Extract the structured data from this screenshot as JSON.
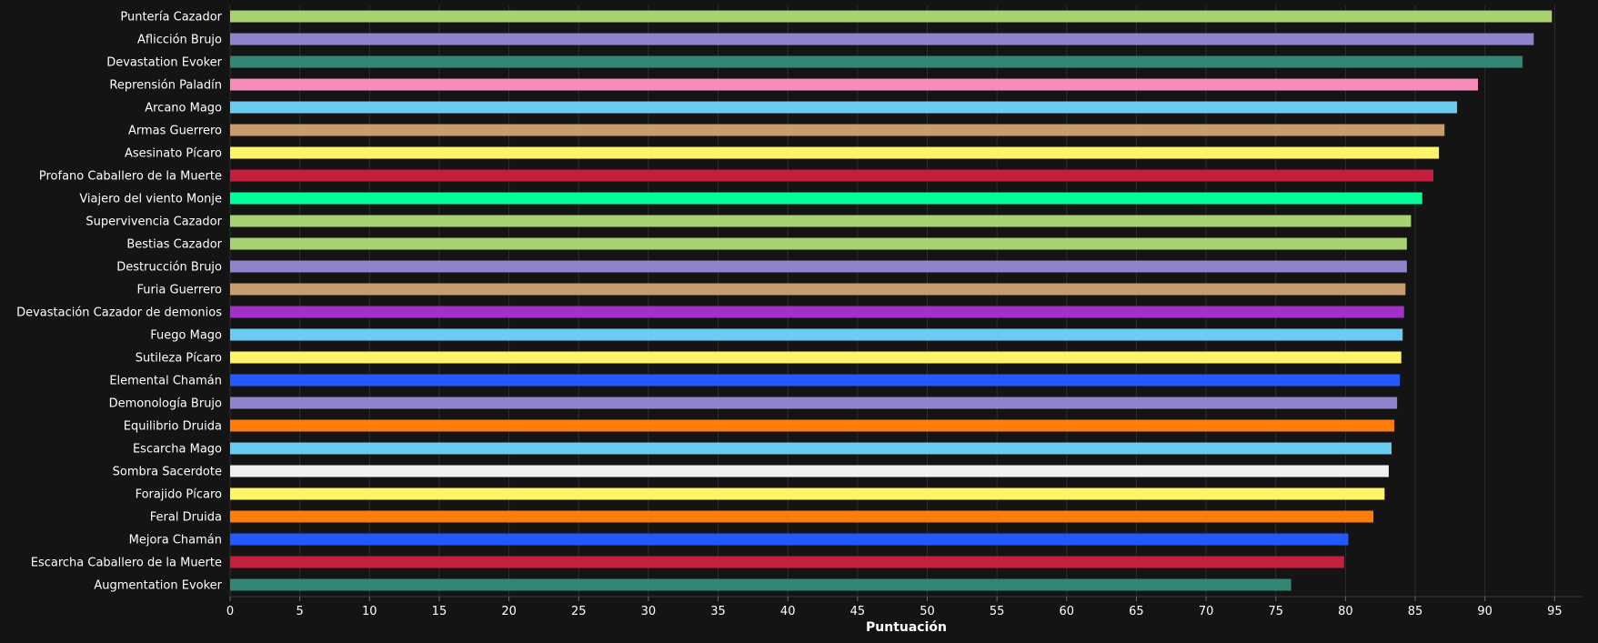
{
  "chart_data": {
    "type": "bar",
    "orientation": "horizontal",
    "title": "",
    "xlabel": "Puntuación",
    "ylabel": "",
    "xlim": [
      0,
      97
    ],
    "xticks": [
      0,
      5,
      10,
      15,
      20,
      25,
      30,
      35,
      40,
      45,
      50,
      55,
      60,
      65,
      70,
      75,
      80,
      85,
      90,
      95
    ],
    "grid": true,
    "legend": "none",
    "background_color": "#141414",
    "bars": [
      {
        "label": "Puntería Cazador",
        "value": 94.8,
        "color": "#a9d271"
      },
      {
        "label": "Aflicción Brujo",
        "value": 93.5,
        "color": "#8f84cb"
      },
      {
        "label": "Devastation Evoker",
        "value": 92.7,
        "color": "#338673"
      },
      {
        "label": "Reprensión Paladín",
        "value": 89.5,
        "color": "#f58cba"
      },
      {
        "label": "Arcano Mago",
        "value": 88.0,
        "color": "#69ccf0"
      },
      {
        "label": "Armas Guerrero",
        "value": 87.1,
        "color": "#c79c6e"
      },
      {
        "label": "Asesinato Pícaro",
        "value": 86.7,
        "color": "#fff468"
      },
      {
        "label": "Profano Caballero de la Muerte",
        "value": 86.3,
        "color": "#c41f3b"
      },
      {
        "label": "Viajero del viento Monje",
        "value": 85.5,
        "color": "#00ff96"
      },
      {
        "label": "Supervivencia Cazador",
        "value": 84.7,
        "color": "#a9d271"
      },
      {
        "label": "Bestias Cazador",
        "value": 84.4,
        "color": "#a9d271"
      },
      {
        "label": "Destrucción Brujo",
        "value": 84.4,
        "color": "#8f84cb"
      },
      {
        "label": "Furia Guerrero",
        "value": 84.3,
        "color": "#c79c6e"
      },
      {
        "label": "Devastación Cazador de demonios",
        "value": 84.2,
        "color": "#a330c9"
      },
      {
        "label": "Fuego Mago",
        "value": 84.1,
        "color": "#69ccf0"
      },
      {
        "label": "Sutileza Pícaro",
        "value": 84.0,
        "color": "#fff468"
      },
      {
        "label": "Elemental Chamán",
        "value": 83.9,
        "color": "#2459ff"
      },
      {
        "label": "Demonología Brujo",
        "value": 83.7,
        "color": "#8f84cb"
      },
      {
        "label": "Equilibrio Druida",
        "value": 83.5,
        "color": "#ff7d0a"
      },
      {
        "label": "Escarcha Mago",
        "value": 83.3,
        "color": "#69ccf0"
      },
      {
        "label": "Sombra Sacerdote",
        "value": 83.1,
        "color": "#f0f0f0"
      },
      {
        "label": "Forajido Pícaro",
        "value": 82.8,
        "color": "#fff468"
      },
      {
        "label": "Feral Druida",
        "value": 82.0,
        "color": "#ff7d0a"
      },
      {
        "label": "Mejora Chamán",
        "value": 80.2,
        "color": "#2459ff"
      },
      {
        "label": "Escarcha Caballero de la Muerte",
        "value": 79.9,
        "color": "#c41f3b"
      },
      {
        "label": "Augmentation Evoker",
        "value": 76.1,
        "color": "#338673"
      }
    ]
  }
}
